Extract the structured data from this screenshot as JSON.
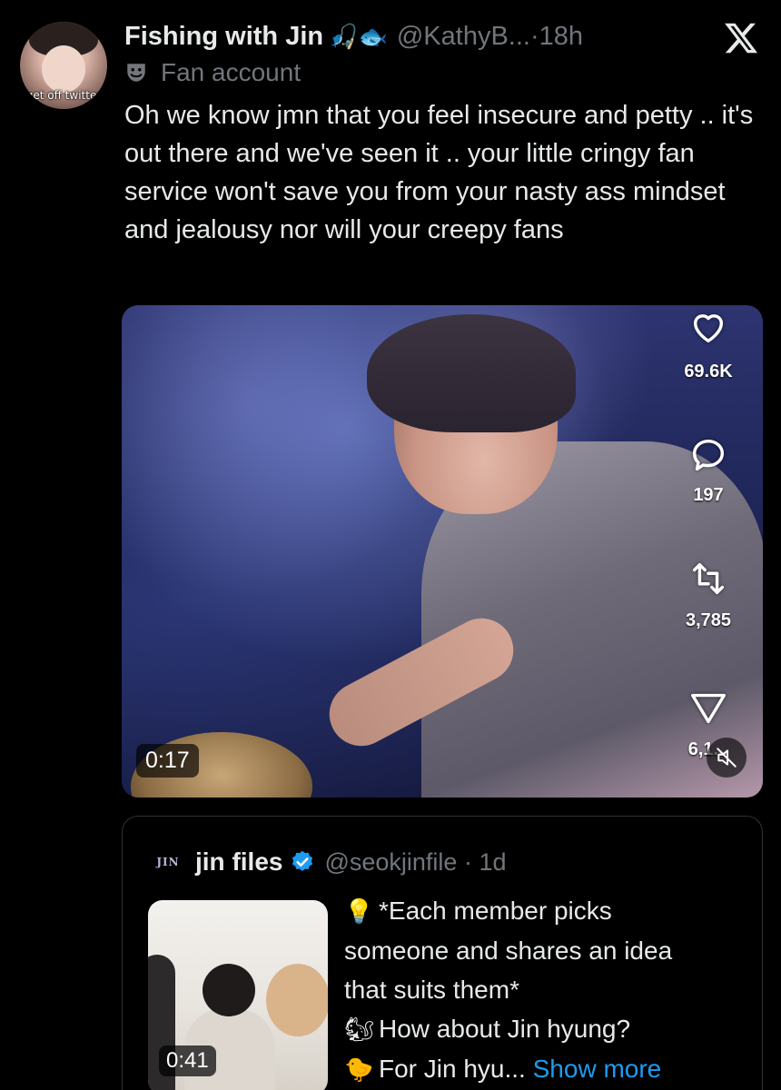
{
  "author": {
    "display_name": "Fishing with Jin",
    "name_emojis": "🎣🐟",
    "handle": "@KathyB...",
    "separator": "·",
    "time": "18h",
    "label": "Fan account",
    "avatar_caption": "get off twitter"
  },
  "tweet": {
    "text": "Oh we know jmn that you feel insecure and petty .. it's out there and we've seen it .. your little cringy fan service won't save you from your nasty ass mindset and jealousy nor will your creepy fans"
  },
  "video": {
    "duration": "0:17",
    "likes": "69.6K",
    "replies": "197",
    "reposts": "3,785",
    "shares": "6,1..."
  },
  "quote": {
    "avatar_text": "JIN",
    "name": "jin files",
    "handle": "@seokjinfile",
    "separator": "·",
    "time": "1d",
    "thumb_duration": "0:41",
    "lines": [
      {
        "emoji": "💡",
        "text": "*Each member picks"
      },
      {
        "emoji": "",
        "text": "someone and shares an idea"
      },
      {
        "emoji": "",
        "text": "that suits them*"
      },
      {
        "emoji": "🐿",
        "text": "How about Jin hyung?"
      },
      {
        "emoji": "🐤",
        "text": "For Jin hyu... "
      }
    ],
    "show_more": "Show more"
  },
  "colors": {
    "background": "#000000",
    "text": "#e7e9ea",
    "secondary": "#71767b",
    "link": "#1d9bf0",
    "verified": "#1d9bf0"
  }
}
